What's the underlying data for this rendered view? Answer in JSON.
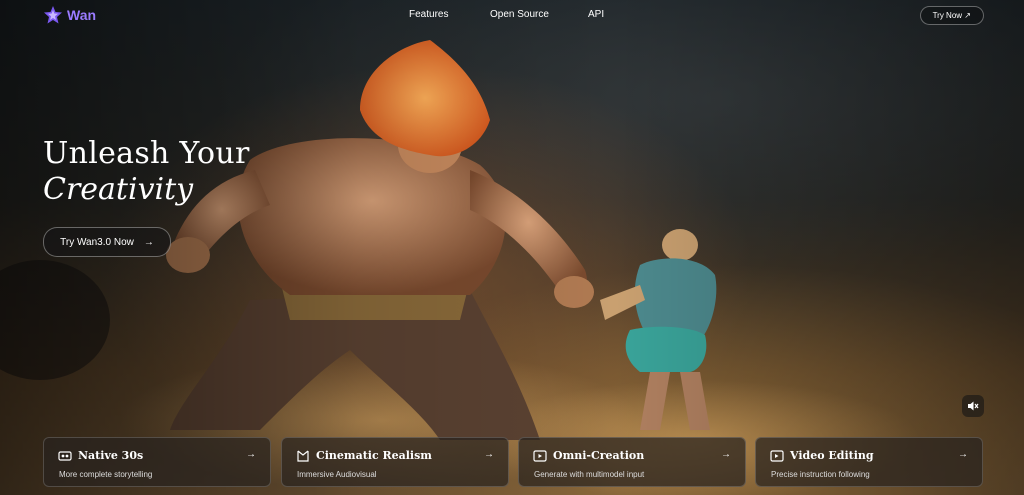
{
  "brand": {
    "name": "Wan",
    "logo_icon": "wan-star-logo",
    "accent": "#9a7bff"
  },
  "nav": {
    "links": [
      "Features",
      "Open Source",
      "API"
    ],
    "cta_label": "Try Now",
    "cta_icon": "arrow-up-right-icon"
  },
  "hero": {
    "line1": "Unleash Your",
    "line2": "Creativity",
    "cta_label": "Try Wan3.0 Now",
    "cta_icon": "arrow-right-icon",
    "sound_icon": "speaker-muted-icon"
  },
  "features": [
    {
      "title": "Native 30s",
      "subtitle": "More complete storytelling",
      "icon": "film-icon"
    },
    {
      "title": "Cinematic Realism",
      "subtitle": "Immersive Audiovisual",
      "icon": "clapper-icon"
    },
    {
      "title": "Omni-Creation",
      "subtitle": "Generate with multimodel input",
      "icon": "play-plus-icon"
    },
    {
      "title": "Video Editing",
      "subtitle": "Precise instruction following",
      "icon": "edit-video-icon"
    }
  ]
}
